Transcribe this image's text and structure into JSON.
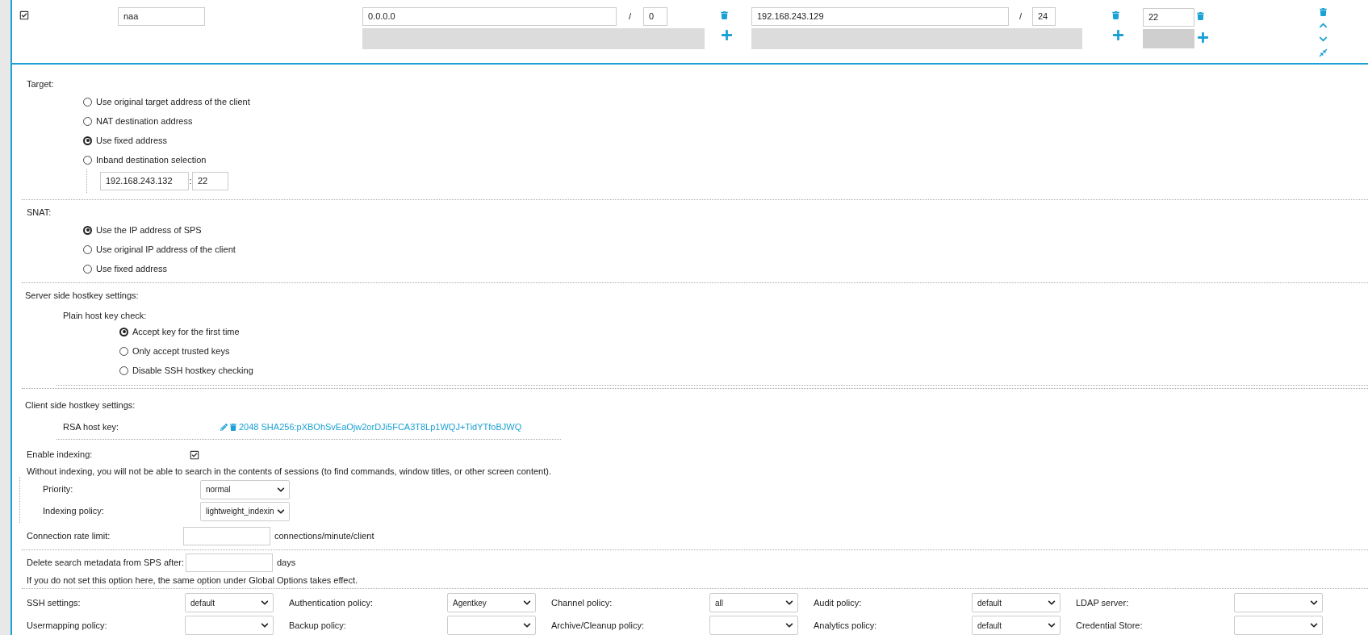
{
  "rule_row": {
    "enabled": true,
    "name_value": "naa",
    "from": {
      "address": "0.0.0.0",
      "separator": "/",
      "prefix": "0"
    },
    "to": {
      "address": "192.168.243.129",
      "separator": "/",
      "prefix": "24"
    },
    "port": "22"
  },
  "target": {
    "label": "Target:",
    "options": [
      {
        "label": "Use original target address of the client",
        "selected": false
      },
      {
        "label": "NAT destination address",
        "selected": false
      },
      {
        "label": "Use fixed address",
        "selected": true
      },
      {
        "label": "Inband destination selection",
        "selected": false
      }
    ],
    "fixed_address": {
      "host": "192.168.243.132",
      "separator": ":",
      "port": "22"
    }
  },
  "snat": {
    "label": "SNAT:",
    "options": [
      {
        "label": "Use the IP address of SPS",
        "selected": true
      },
      {
        "label": "Use original IP address of the client",
        "selected": false
      },
      {
        "label": "Use fixed address",
        "selected": false
      }
    ]
  },
  "server_hostkey": {
    "label": "Server side hostkey settings:",
    "sublabel": "Plain host key check:",
    "options": [
      {
        "label": "Accept key for the first time",
        "selected": true
      },
      {
        "label": "Only accept trusted keys",
        "selected": false
      },
      {
        "label": "Disable SSH hostkey checking",
        "selected": false
      }
    ]
  },
  "client_hostkey": {
    "label": "Client side hostkey settings:",
    "rsa_label": "RSA host key:",
    "rsa_value": "2048 SHA256:pXBOhSvEaOjw2orDJi5FCA3T8Lp1WQJ+TidYTfoBJWQ"
  },
  "indexing": {
    "label": "Enable indexing:",
    "checked": true,
    "note": "Without indexing, you will not be able to search in the contents of sessions (to find commands, window titles, or other screen content).",
    "priority": {
      "label": "Priority:",
      "value": "normal"
    },
    "policy": {
      "label": "Indexing policy:",
      "value": "lightweight_indexin"
    }
  },
  "rate_limit": {
    "label": "Connection rate limit:",
    "unit": "connections/minute/client"
  },
  "delete_metadata": {
    "label": "Delete search metadata from SPS after:",
    "unit": "days",
    "note": "If you do not set this option here, the same option under Global Options takes effect."
  },
  "policies": [
    {
      "label": "SSH settings:",
      "value": "default"
    },
    {
      "label": "Authentication policy:",
      "value": "Agentkey"
    },
    {
      "label": "Channel policy:",
      "value": "all"
    },
    {
      "label": "Audit policy:",
      "value": "default"
    },
    {
      "label": "LDAP server:"
    },
    {
      "label": "Usermapping policy:"
    },
    {
      "label": "Backup policy:"
    },
    {
      "label": "Archive/Cleanup policy:"
    },
    {
      "label": "Analytics policy:",
      "value": "default"
    },
    {
      "label": "Credential Store:"
    }
  ]
}
